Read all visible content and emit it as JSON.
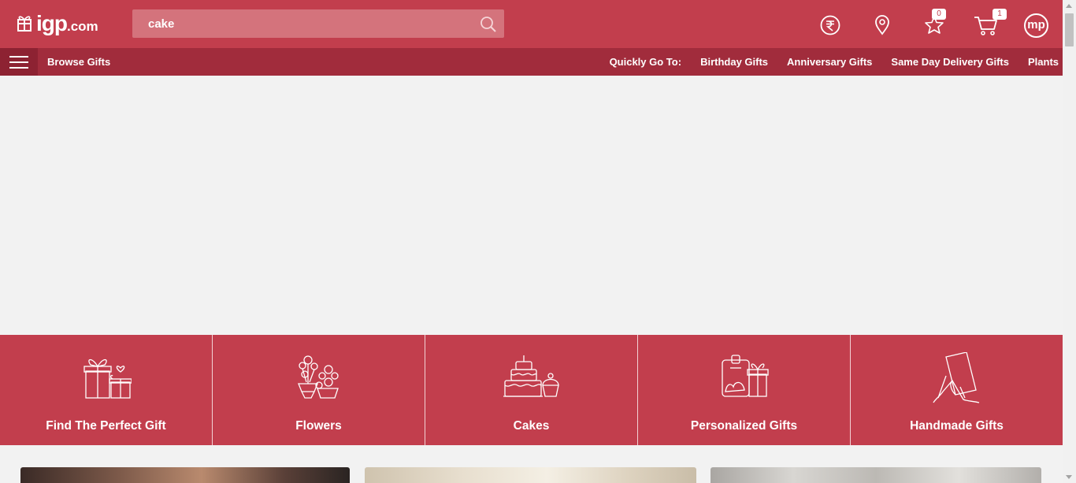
{
  "header": {
    "logo_text": "igp",
    "logo_suffix": ".com",
    "search_value": "cake",
    "wishlist_count": "0",
    "cart_count": "1",
    "avatar_initials": "mp"
  },
  "nav": {
    "browse_label": "Browse Gifts",
    "quick_label": "Quickly Go To:",
    "quick_links": [
      "Birthday Gifts",
      "Anniversary Gifts",
      "Same Day Delivery Gifts",
      "Plants"
    ]
  },
  "categories": [
    {
      "label": "Find The Perfect Gift",
      "icon": "gift-boxes-icon"
    },
    {
      "label": "Flowers",
      "icon": "flowers-icon"
    },
    {
      "label": "Cakes",
      "icon": "cake-icon"
    },
    {
      "label": "Personalized Gifts",
      "icon": "personalized-gift-icon"
    },
    {
      "label": "Handmade Gifts",
      "icon": "handmade-card-icon"
    }
  ],
  "colors": {
    "brand": "#c23e4d",
    "nav": "#a12c3c",
    "search_bg": "#d4737c",
    "page_bg": "#f2f2f2"
  }
}
